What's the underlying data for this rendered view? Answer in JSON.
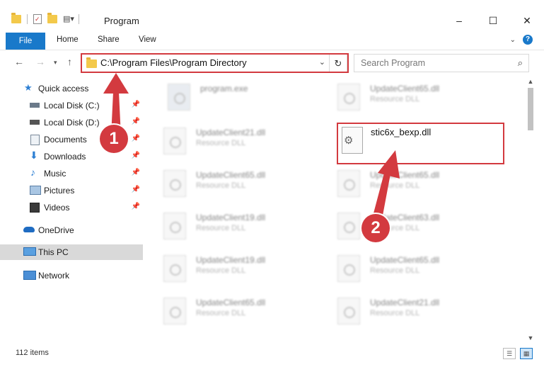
{
  "window": {
    "title": "Program",
    "controls": [
      "–",
      "☐",
      "✕"
    ]
  },
  "ribbon": {
    "tabs": [
      "File",
      "Home",
      "Share",
      "View"
    ]
  },
  "navigation": {
    "address_path": "C:\\Program Files\\Program Directory",
    "search_placeholder": "Search Program"
  },
  "sidebar": {
    "items": [
      {
        "label": "Quick access",
        "icon": "star-icon"
      },
      {
        "label": "Local Disk (C:)",
        "icon": "drive-icon"
      },
      {
        "label": "Local Disk (D:)",
        "icon": "drive-icon"
      },
      {
        "label": "Documents",
        "icon": "document-icon"
      },
      {
        "label": "Downloads",
        "icon": "download-icon"
      },
      {
        "label": "Music",
        "icon": "music-icon"
      },
      {
        "label": "Pictures",
        "icon": "pictures-icon"
      },
      {
        "label": "Videos",
        "icon": "video-icon"
      },
      {
        "label": "OneDrive",
        "icon": "cloud-icon"
      },
      {
        "label": "This PC",
        "icon": "computer-icon"
      },
      {
        "label": "Network",
        "icon": "network-icon"
      }
    ]
  },
  "files": [
    {
      "name": "program.exe",
      "type": ""
    },
    {
      "name": "UpdateClient65.dll",
      "type": "Resource DLL"
    },
    {
      "name": "UpdateClient21.dll",
      "type": "Resource DLL"
    },
    {
      "name": "UpdateClient65.dll",
      "type": "Resource DLL"
    },
    {
      "name": "UpdateClient65.dll",
      "type": "Resource DLL"
    },
    {
      "name": "UpdateClient19.dll",
      "type": "Resource DLL"
    },
    {
      "name": "UpdateClient63.dll",
      "type": "Resource DLL"
    },
    {
      "name": "UpdateClient19.dll",
      "type": "Resource DLL"
    },
    {
      "name": "UpdateClient65.dll",
      "type": "Resource DLL"
    },
    {
      "name": "UpdateClient65.dll",
      "type": "Resource DLL"
    },
    {
      "name": "UpdateClient21.dll",
      "type": "Resource DLL"
    }
  ],
  "highlighted_file": {
    "name": "stic6x_bexp.dll"
  },
  "annotations": {
    "step1": "1",
    "step2": "2",
    "color": "#d33a3f"
  },
  "status": {
    "item_count": "112 items"
  }
}
